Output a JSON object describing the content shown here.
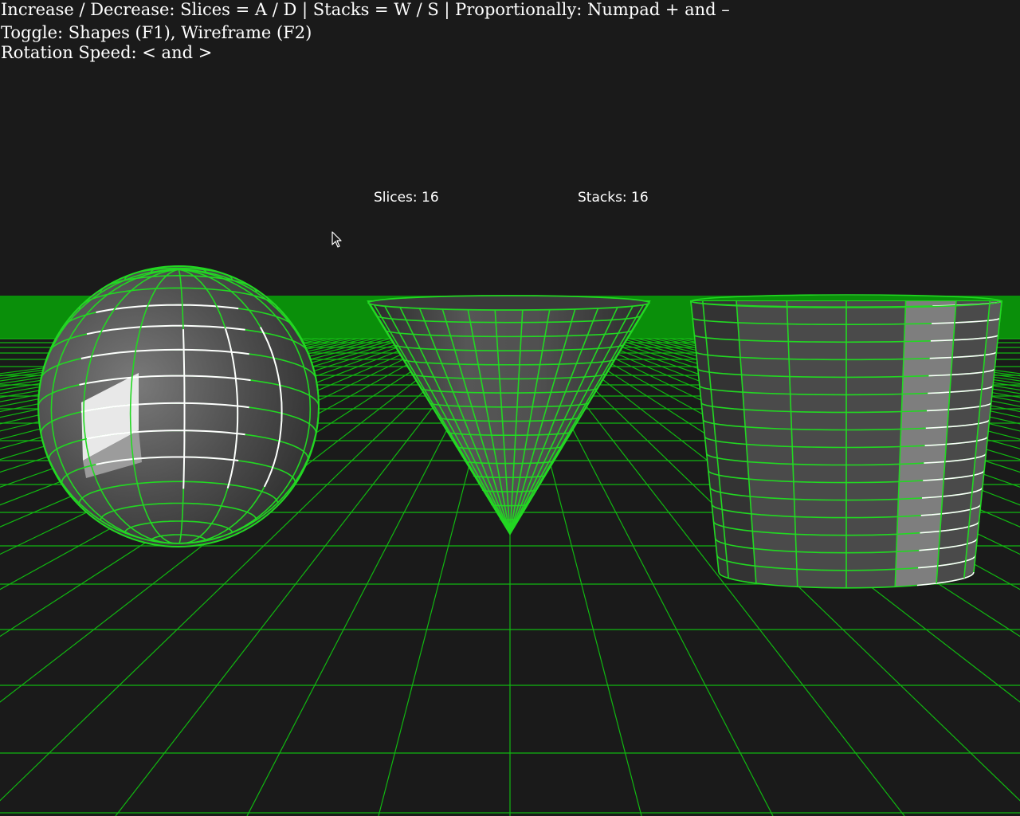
{
  "help_text": {
    "line1": "Increase / Decrease: Slices = A / D | Stacks = W / S | Proportionally: Numpad + and –",
    "line2": "Toggle: Shapes (F1), Wireframe (F2)",
    "line3": "Rotation Speed: < and >"
  },
  "readouts": {
    "slices": "Slices: 16",
    "stacks": "Stacks: 16"
  },
  "parameters": {
    "slices": 16,
    "stacks": 16
  },
  "shapes": [
    "sphere",
    "cone",
    "cylinder"
  ],
  "colors": {
    "background": "#1a1a1a",
    "ground_fill": "#0a8f0a",
    "grid_line": "#11b811",
    "wire_green": "#22d822",
    "wire_highlight": "#ffffff",
    "shape_light": "#9a9a9a",
    "shape_mid": "#5a5a5a",
    "shape_dark": "#2e2e2e",
    "highlight_face": "#e8e8e8",
    "highlight_band": "#888888",
    "text": "#ffffff"
  },
  "icons": {
    "cursor": "mouse-pointer-icon"
  }
}
